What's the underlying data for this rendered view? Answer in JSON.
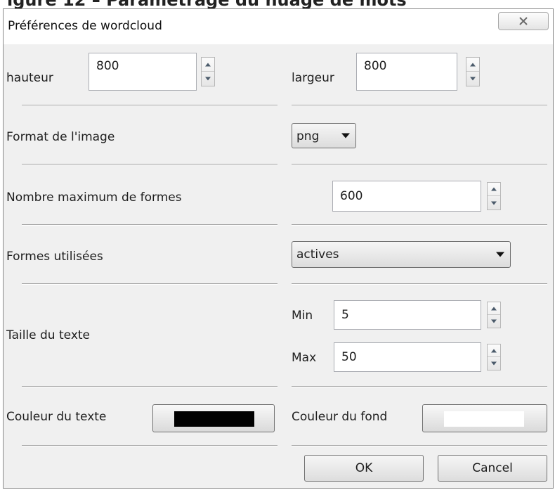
{
  "dialog": {
    "title": "Préférences de wordcloud",
    "close_icon": "close-icon"
  },
  "size": {
    "height_label": "hauteur",
    "height_value": "800",
    "width_label": "largeur",
    "width_value": "800"
  },
  "image_format": {
    "label": "Format de l'image",
    "selected": "png"
  },
  "max_forms": {
    "label": "Nombre maximum de formes",
    "value": "600"
  },
  "forms_used": {
    "label": "Formes utilisées",
    "selected": "actives"
  },
  "text_size": {
    "label": "Taille du texte",
    "min_label": "Min",
    "min_value": "5",
    "max_label": "Max",
    "max_value": "50"
  },
  "colors": {
    "text_label": "Couleur du texte",
    "text_color": "#000000",
    "background_label": "Couleur du fond",
    "background_color": "#ffffff"
  },
  "buttons": {
    "ok": "OK",
    "cancel": "Cancel"
  }
}
